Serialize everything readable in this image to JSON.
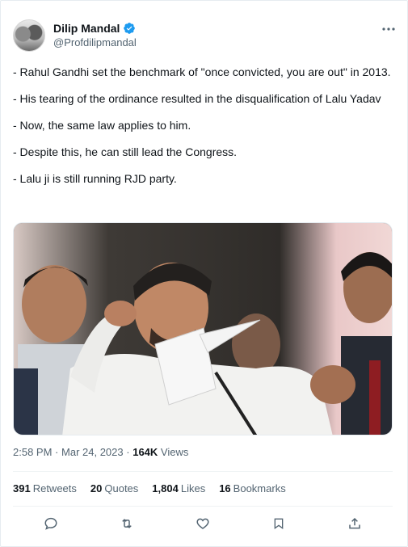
{
  "author": {
    "display_name": "Dilip Mandal",
    "handle": "@Profdilipmandal",
    "avatar_icon": "avatar",
    "verified_icon": "verified-badge-icon"
  },
  "menu_icon": "more-options-icon",
  "tweet": {
    "paragraphs": [
      "- Rahul Gandhi set the benchmark of \"once convicted, you are out\" in 2013.",
      "- His tearing of the ordinance resulted in the disqualification of Lalu Yadav",
      "- Now, the same law applies to him.",
      "- Despite this, he can still lead the Congress.",
      "- Lalu ji is still running RJD party."
    ]
  },
  "meta": {
    "time": "2:58 PM",
    "separator": "·",
    "date": "Mar 24, 2023",
    "views_count": "164K",
    "views_label": "Views"
  },
  "stats": [
    {
      "count": "391",
      "label": "Retweets"
    },
    {
      "count": "20",
      "label": "Quotes"
    },
    {
      "count": "1,804",
      "label": "Likes"
    },
    {
      "count": "16",
      "label": "Bookmarks"
    }
  ],
  "actions": [
    "reply-icon",
    "retweet-icon",
    "like-icon",
    "bookmark-icon",
    "share-icon"
  ],
  "colors": {
    "accent": "#1d9bf0",
    "text": "#0f1419",
    "secondary": "#536471",
    "icon": "#536471"
  }
}
